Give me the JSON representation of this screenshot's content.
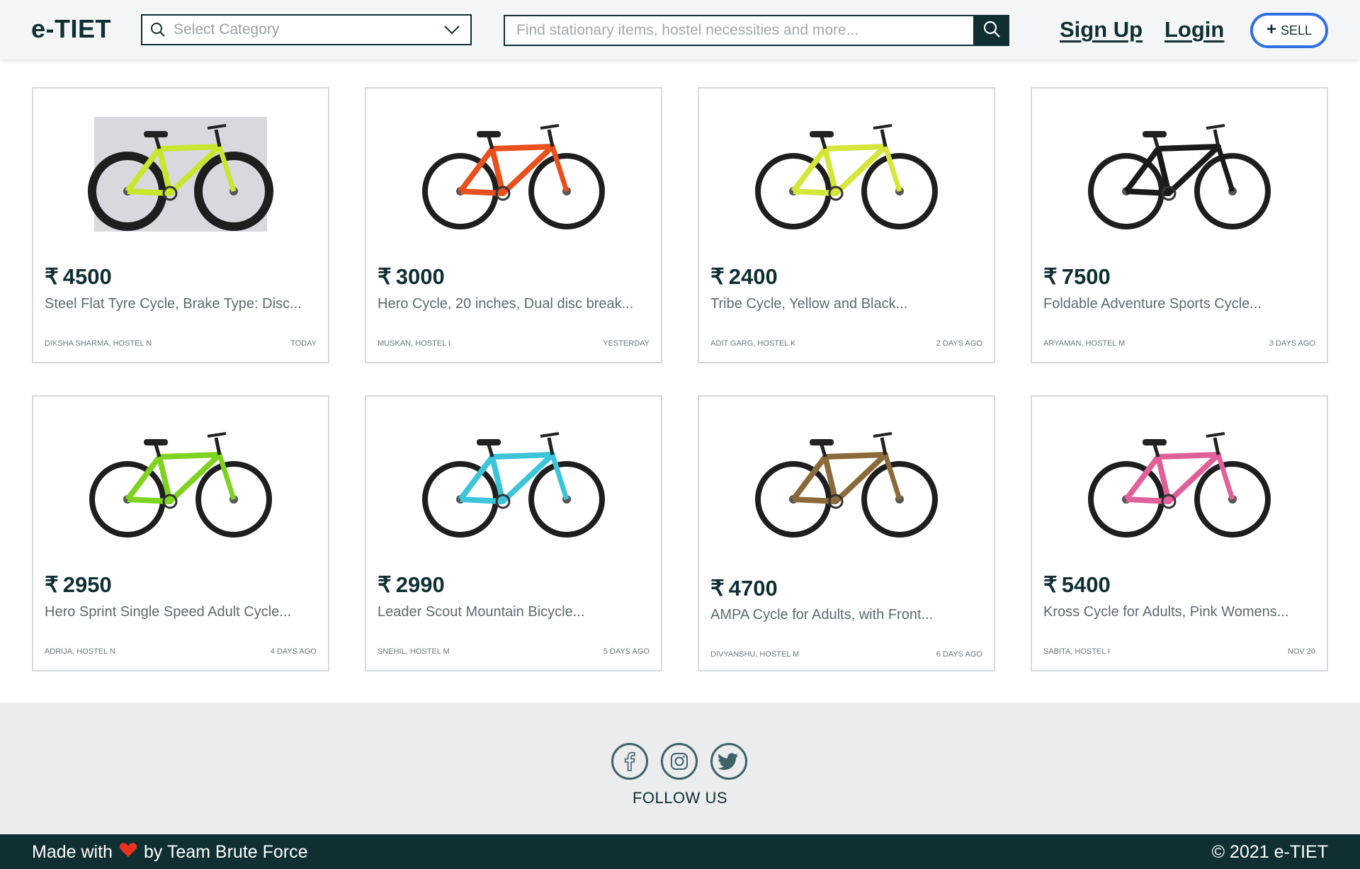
{
  "header": {
    "logo": "e-TIET",
    "category_placeholder": "Select Category",
    "search_placeholder": "Find stationary items, hostel necessities and more...",
    "signup": "Sign Up",
    "login": "Login",
    "sell": "SELL"
  },
  "currency_symbol": "₹",
  "listings": [
    {
      "price": "4500",
      "title": "Steel Flat Tyre Cycle, Brake Type: Disc...",
      "seller": "DIKSHA SHARMA, HOSTEL N",
      "date": "TODAY",
      "frame_color": "#c8e62e"
    },
    {
      "price": "3000",
      "title": "Hero Cycle, 20 inches, Dual disc break...",
      "seller": "MUSKAN, HOSTEL I",
      "date": "YESTERDAY",
      "frame_color": "#e8501e"
    },
    {
      "price": "2400",
      "title": "Tribe Cycle, Yellow and Black...",
      "seller": "ADIT GARG, HOSTEL K",
      "date": "2 DAYS AGO",
      "frame_color": "#d4e63a"
    },
    {
      "price": "7500",
      "title": "Foldable Adventure Sports Cycle...",
      "seller": "ARYAMAN, HOSTEL M",
      "date": "3 DAYS AGO",
      "frame_color": "#1a1a1a"
    },
    {
      "price": "2950",
      "title": "Hero Sprint Single Speed Adult Cycle...",
      "seller": "ADRIJA, HOSTEL N",
      "date": "4 DAYS AGO",
      "frame_color": "#7ed321"
    },
    {
      "price": "2990",
      "title": "Leader Scout Mountain Bicycle...",
      "seller": "SNEHIL, HOSTEL M",
      "date": "5 DAYS AGO",
      "frame_color": "#3cc4d8"
    },
    {
      "price": "4700",
      "title": "AMPA Cycle for Adults, with Front...",
      "seller": "DIVYANSHU, HOSTEL M",
      "date": "6 DAYS AGO",
      "frame_color": "#8a6a3a"
    },
    {
      "price": "5400",
      "title": "Kross Cycle for Adults, Pink Womens...",
      "seller": "SABITA, HOSTEL I",
      "date": "NOV 20",
      "frame_color": "#e0609a"
    }
  ],
  "footer": {
    "follow_us": "FOLLOW US",
    "social_icons": [
      "facebook-icon",
      "instagram-icon",
      "twitter-icon"
    ],
    "made_with": "Made with",
    "by_team": "by Team Brute Force",
    "copyright": "© 2021 e-TIET"
  },
  "colors": {
    "brand_dark": "#0f2f33",
    "sell_border": "#2f6fe8",
    "heart": "#e8321e"
  }
}
